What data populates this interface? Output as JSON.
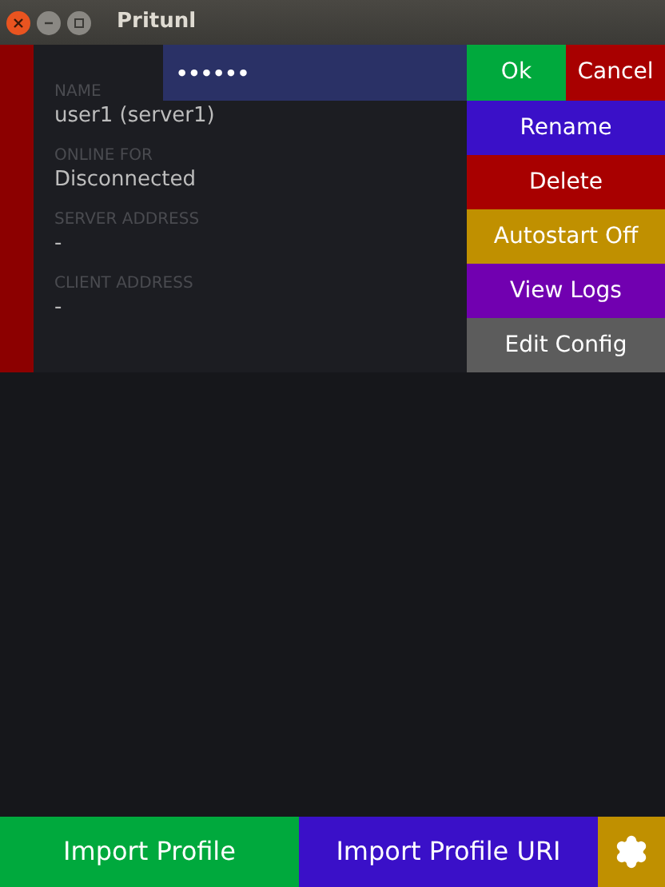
{
  "window": {
    "title": "Pritunl"
  },
  "profile": {
    "fields": [
      {
        "label": "NAME",
        "value": "user1 (server1)"
      },
      {
        "label": "ONLINE FOR",
        "value": "Disconnected"
      },
      {
        "label": "SERVER ADDRESS",
        "value": "-"
      },
      {
        "label": "CLIENT ADDRESS",
        "value": "-"
      }
    ]
  },
  "password_field": {
    "value": "••••••"
  },
  "confirm_buttons": [
    {
      "label": "Ok",
      "color": "#00a93d"
    },
    {
      "label": "Cancel",
      "color": "#a80000"
    }
  ],
  "menu": [
    {
      "label": "Rename",
      "color": "#3a10c8"
    },
    {
      "label": "Delete",
      "color": "#a80000"
    },
    {
      "label": "Autostart Off",
      "color": "#c09000"
    },
    {
      "label": "View Logs",
      "color": "#7100b0"
    },
    {
      "label": "Edit Config",
      "color": "#5c5c5c"
    }
  ],
  "bottom_bar": [
    {
      "kind": "text",
      "label": "Import Profile",
      "color": "#00a93d"
    },
    {
      "kind": "text",
      "label": "Import Profile URI",
      "color": "#3a10c8"
    },
    {
      "kind": "gear",
      "color": "#c09000"
    }
  ]
}
